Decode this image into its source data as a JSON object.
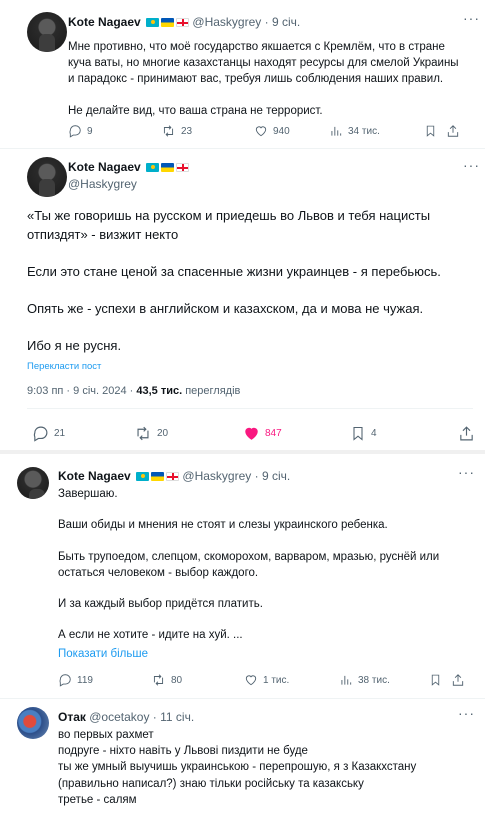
{
  "tweet1": {
    "name": "Kote Nagaev",
    "handle": "@Haskygrey",
    "time": "9 січ.",
    "body": "Мне противно, что моё государство якшается с Кремлём, что в стране\nкуча ваты, но многие казахстанцы находят ресурсы для смелой Украины\nи парадокс - принимают вас, требуя лишь соблюдения наших правил.\n\nНе делайте вид, что ваша страна не террорист.",
    "replies": "9",
    "retweets": "23",
    "likes": "940",
    "views": "34 тис."
  },
  "tweet2": {
    "name": "Kote Nagaev",
    "handle": "@Haskygrey",
    "body": "«Ты же говоришь на русском и приедешь во Львов и тебя нацисты\nотпиздят» - визжит некто\n\nЕсли это стане ценой за спасенные жизни  украинцев - я перебьюсь.\n\nОпять же - успехи в английском и казахском, да и мова не чужая.\n\nИбо я не русня.",
    "translate": "Перекласти пост",
    "timestamp": "9:03 пп · 9 січ. 2024 · ",
    "views_count": "43,5 тис.",
    "views_label": " переглядів",
    "replies": "21",
    "retweets": "20",
    "likes": "847",
    "bookmarks": "4"
  },
  "tweet3": {
    "name": "Kote Nagaev",
    "handle": "@Haskygrey",
    "time": "9 січ.",
    "body": "Завершаю.\n\nВаши обиды и мнения не стоят и слезы украинского ребенка.\n\nБыть трупоедом, слепцом, скоморохом, варваром, мразью, руснёй или\nостаться человеком - выбор каждого.\n\nИ за каждый выбор придётся платить.\n\nА если не хотите - идите на хуй. ...",
    "show_more": "Показати більше",
    "replies": "119",
    "retweets": "80",
    "likes": "1 тис.",
    "views": "38 тис."
  },
  "tweet4": {
    "name": "Отак",
    "handle": "@ocetakoy",
    "time": "11 січ.",
    "body": "во первых рахмет\nподруге - ніхто навіть у Львові пиздити не буде\nты же умный выучишь украинською - перепрошую, я з Казакхстану\n(правильно написал?) знаю тільки російську та казакську\nтретье - салям"
  },
  "colors": {
    "link": "#1d9bf0",
    "like_active": "#f91880",
    "text_secondary": "#536471"
  }
}
